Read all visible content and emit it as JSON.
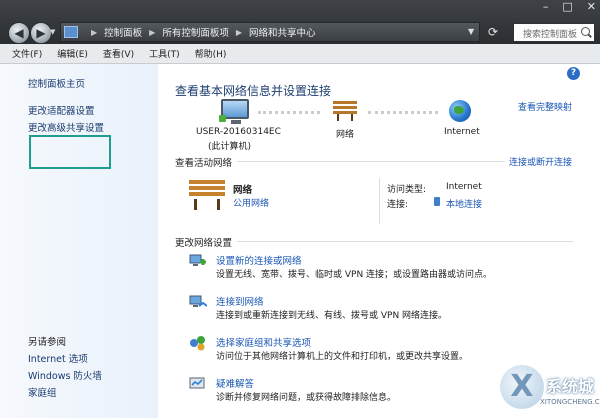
{
  "address": {
    "crumbs": [
      "控制面板",
      "所有控制面板项",
      "网络和共享中心"
    ],
    "search_placeholder": "搜索控制面板"
  },
  "menu": [
    "文件(F)",
    "编辑(E)",
    "查看(V)",
    "工具(T)",
    "帮助(H)"
  ],
  "left_pane": {
    "top_links": [
      "控制面板主页",
      "更改适配器设置",
      "更改高级共享设置"
    ],
    "see_also_title": "另请参阅",
    "see_also": [
      "Internet 选项",
      "Windows 防火墙",
      "家庭组"
    ]
  },
  "main": {
    "title": "查看基本网络信息并设置连接",
    "view_full_map": "查看完整映射",
    "map": {
      "computer_name": "USER-20160314EC",
      "computer_sub": "(此计算机)",
      "network": "网络",
      "internet": "Internet"
    },
    "active": {
      "title": "查看活动网络",
      "connect_disconnect": "连接或断开连接",
      "network_name": "网络",
      "network_type": "公用网络",
      "access_type_label": "访问类型:",
      "access_type_value": "Internet",
      "connection_label": "连接:",
      "connection_value": "本地连接"
    },
    "change": {
      "title": "更改网络设置",
      "tasks": [
        {
          "title": "设置新的连接或网络",
          "desc": "设置无线、宽带、拨号、临时或 VPN 连接；或设置路由器或访问点。"
        },
        {
          "title": "连接到网络",
          "desc": "连接到或重新连接到无线、有线、拨号或 VPN 网络连接。"
        },
        {
          "title": "选择家庭组和共享选项",
          "desc": "访问位于其他网络计算机上的文件和打印机，或更改共享设置。"
        },
        {
          "title": "疑难解答",
          "desc": "诊断并修复网络问题，或获得故障排除信息。"
        }
      ]
    }
  },
  "watermark": {
    "text": "系统城",
    "url": "XITONGCHENG.COM"
  }
}
